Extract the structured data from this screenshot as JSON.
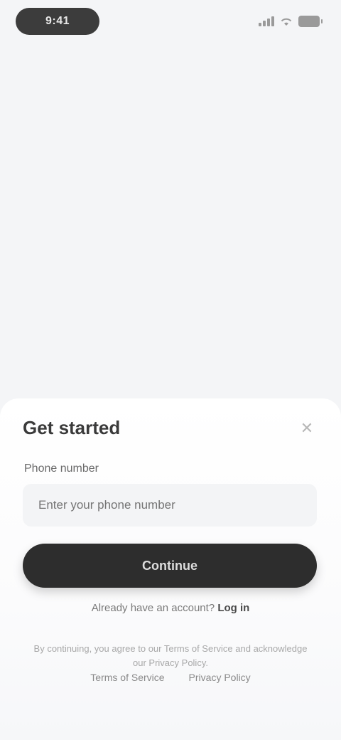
{
  "status_bar": {
    "time": "9:41",
    "icons": [
      "signal-icon",
      "wifi-icon",
      "battery-icon"
    ]
  },
  "sheet": {
    "title": "Get started",
    "close_icon": "close-icon",
    "field_label": "Phone number",
    "phone_placeholder": "Enter your phone number",
    "continue_label": "Continue",
    "alt_prompt": "Already have an account?",
    "alt_action": "Log in",
    "legal_text": "By continuing, you agree to our Terms of Service and acknowledge our Privacy Policy.",
    "terms_link": "Terms of Service",
    "privacy_link": "Privacy Policy"
  },
  "colors": {
    "background": "#f4f5f7",
    "button": "#2d2d2d",
    "pill": "#3c3c3c"
  }
}
